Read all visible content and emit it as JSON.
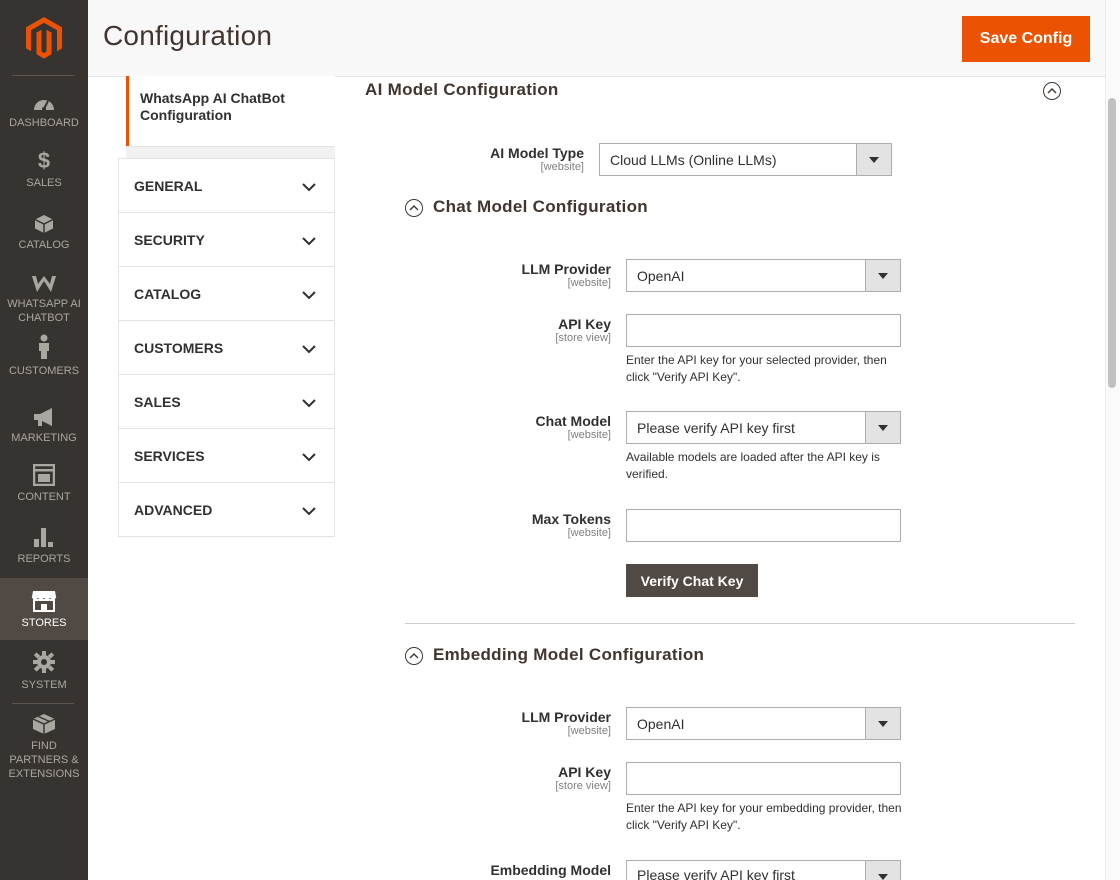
{
  "menu": {
    "items": [
      {
        "label": "DASHBOARD",
        "icon": "dashboard-icon"
      },
      {
        "label": "SALES",
        "icon": "dollar-icon"
      },
      {
        "label": "CATALOG",
        "icon": "cube-icon"
      },
      {
        "label": "WHATSAPP AI CHATBOT",
        "icon": "whatsapp-chatbot-icon"
      },
      {
        "label": "CUSTOMERS",
        "icon": "person-icon"
      },
      {
        "label": "MARKETING",
        "icon": "megaphone-icon"
      },
      {
        "label": "CONTENT",
        "icon": "content-icon"
      },
      {
        "label": "REPORTS",
        "icon": "bar-chart-icon"
      },
      {
        "label": "STORES",
        "icon": "store-icon"
      },
      {
        "label": "SYSTEM",
        "icon": "gear-icon"
      },
      {
        "label": "FIND PARTNERS & EXTENSIONS",
        "icon": "extensions-icon"
      }
    ]
  },
  "header": {
    "title": "Configuration",
    "save_label": "Save Config"
  },
  "tabs": {
    "active": "WhatsApp AI ChatBot Configuration",
    "items": [
      "GENERAL",
      "SECURITY",
      "CATALOG",
      "CUSTOMERS",
      "SALES",
      "SERVICES",
      "ADVANCED"
    ]
  },
  "section": {
    "title": "AI Model Configuration",
    "model_type": {
      "label": "AI Model Type",
      "scope": "[website]",
      "value": "Cloud LLMs (Online LLMs)"
    }
  },
  "chat": {
    "title": "Chat Model Configuration",
    "provider": {
      "label": "LLM Provider",
      "scope": "[website]",
      "value": "OpenAI"
    },
    "api_key": {
      "label": "API Key",
      "scope": "[store view]",
      "value": "",
      "note": "Enter the API key for your selected provider, then click \"Verify API Key\"."
    },
    "model": {
      "label": "Chat Model",
      "scope": "[website]",
      "value": "Please verify API key first",
      "note": "Available models are loaded after the API key is verified."
    },
    "max_tokens": {
      "label": "Max Tokens",
      "scope": "[website]",
      "value": ""
    },
    "verify_label": "Verify Chat Key"
  },
  "embedding": {
    "title": "Embedding Model Configuration",
    "provider": {
      "label": "LLM Provider",
      "scope": "[website]",
      "value": "OpenAI"
    },
    "api_key": {
      "label": "API Key",
      "scope": "[store view]",
      "value": "",
      "note": "Enter the API key for your embedding provider, then click \"Verify API Key\"."
    },
    "model": {
      "label": "Embedding Model",
      "value": "Please verify API key first"
    }
  },
  "colors": {
    "accent": "#eb5202",
    "menu_bg": "#373330",
    "button_dark": "#514943"
  }
}
